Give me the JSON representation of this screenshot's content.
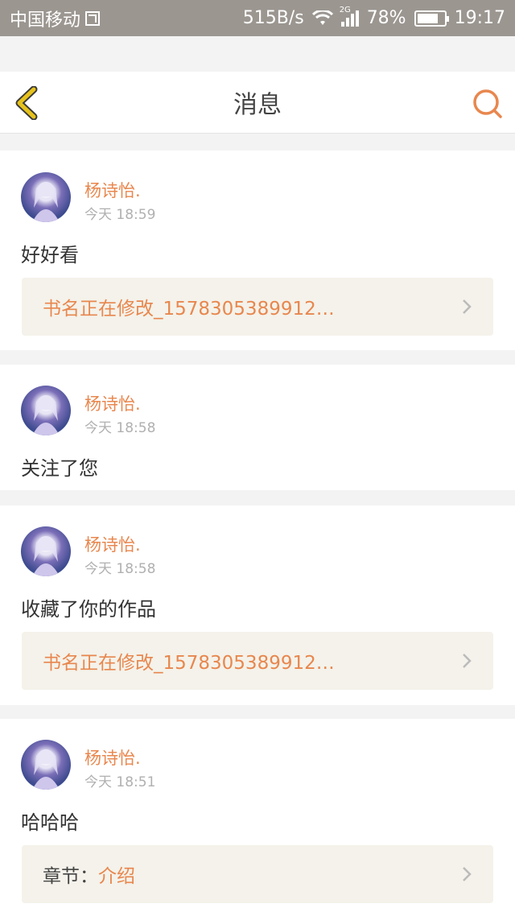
{
  "status_bar": {
    "carrier": "中国移动",
    "speed": "515B/s",
    "network": "2G",
    "battery": "78%",
    "battery_level": 0.78,
    "time": "19:17"
  },
  "header": {
    "title": "消息",
    "back_icon": "chevron-left-icon",
    "search_icon": "search-icon"
  },
  "messages": [
    {
      "username": "杨诗怡.",
      "time": "今天 18:59",
      "text": "好好看",
      "link": {
        "prefix": "",
        "text": "书名正在修改_1578305389912…"
      }
    },
    {
      "username": "杨诗怡.",
      "time": "今天 18:58",
      "text": "关注了您"
    },
    {
      "username": "杨诗怡.",
      "time": "今天 18:58",
      "text": "收藏了你的作品",
      "link": {
        "prefix": "",
        "text": "书名正在修改_1578305389912…"
      }
    },
    {
      "username": "杨诗怡.",
      "time": "今天 18:51",
      "text": "哈哈哈",
      "link": {
        "prefix": "章节：",
        "text": "介绍"
      }
    }
  ],
  "colors": {
    "accent": "#e8874e",
    "back_icon": "#e6c21c",
    "link_bg": "#f4f2ea"
  }
}
